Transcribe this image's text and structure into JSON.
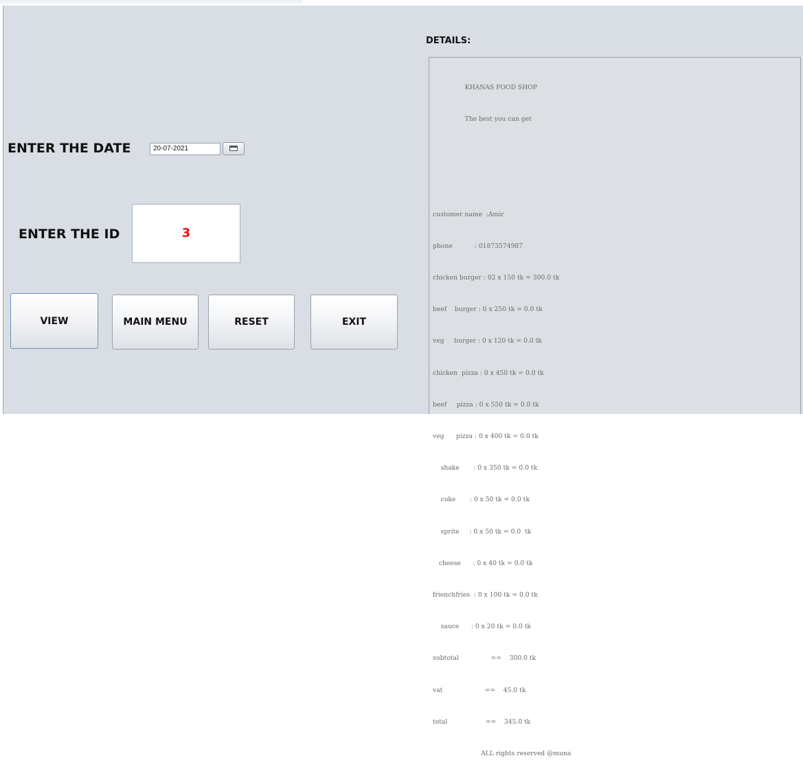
{
  "form": {
    "date_label": "ENTER THE DATE",
    "date_value": "20-07-2021",
    "id_label": "ENTER THE ID",
    "id_value": "3"
  },
  "buttons": {
    "view": "VIEW",
    "main_menu": "MAIN MENU",
    "reset": "RESET",
    "exit": "EXIT"
  },
  "details": {
    "label": "DETAILS:",
    "receipt_lines": [
      "                KHANAS FOOD SHOP",
      "                The best you can get",
      "",
      "",
      "customer name  :Amir",
      "phone           : 01873574987",
      "chicken burger : 02 x 150 tk = 300.0 tk",
      "beef    burger : 0 x 250 tk = 0.0 tk",
      "veg     burger : 0 x 120 tk = 0.0 tk",
      "chicken  pizza : 0 x 450 tk = 0.0 tk",
      "beef     pizza : 0 x 550 tk = 0.0 tk",
      "veg      pizza : 0 x 400 tk = 0.0 tk",
      "    shake       : 0 x 350 tk = 0.0 tk",
      "    coke       : 0 x 50 tk = 0.0 tk",
      "    sprite     : 0 x 50 tk = 0.0  tk",
      "   cheese      : 0 x 40 tk = 0.0 tk",
      "frienchfries  : 0 x 100 tk = 0.0 tk",
      "    sauce      : 0 x 20 tk = 0.0 tk",
      "subtotal                ==    300.0 tk",
      "vat                     ==    45.0 tk",
      "total                   ==    345.0 tk",
      "                        ALL rights reserved @muna"
    ]
  },
  "colors": {
    "panel_bg": "#d9dde4",
    "id_value_color": "#ee1111",
    "receipt_text": "#6a6a6a"
  },
  "icons": {
    "date_picker": "calendar-icon"
  }
}
